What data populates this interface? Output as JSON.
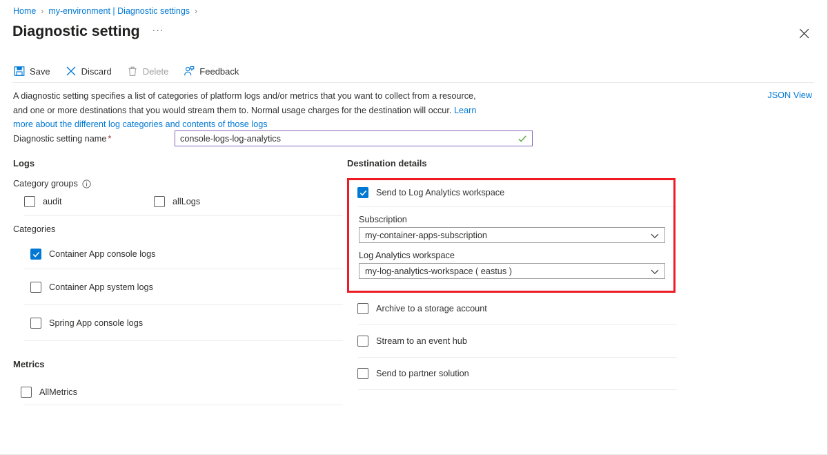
{
  "breadcrumb": {
    "items": [
      {
        "label": "Home",
        "separator": "›"
      },
      {
        "label": "my-environment | Diagnostic settings",
        "separator": "›"
      }
    ]
  },
  "header": {
    "title": "Diagnostic setting",
    "more_label": "···",
    "close_icon": "close-icon"
  },
  "toolbar": {
    "save_label": "Save",
    "discard_label": "Discard",
    "delete_label": "Delete",
    "feedback_label": "Feedback"
  },
  "description": {
    "line1": "A diagnostic setting specifies a list of categories of platform logs and/or metrics that you want to collect from a resource,",
    "line2": "and one or more destinations that you would stream them to. Normal usage charges for the destination will occur. ",
    "link_text": "Learn more about the different log categories and contents of those logs",
    "json_view_label": "JSON View"
  },
  "name_field": {
    "label": "Diagnostic setting name",
    "required_marker": "*",
    "value": "console-logs-log-analytics",
    "placeholder": "",
    "valid": true,
    "border_color": "#8764b8",
    "check_color": "#5aa63a"
  },
  "logs": {
    "section_title": "Logs",
    "category_groups": {
      "label": "Category groups",
      "info_icon": "info-icon",
      "items": [
        {
          "label": "audit",
          "checked": false
        },
        {
          "label": "allLogs",
          "checked": false
        }
      ]
    },
    "categories": {
      "label": "Categories",
      "items": [
        {
          "label": "Container App console logs",
          "checked": true
        },
        {
          "label": "Container App system logs",
          "checked": false
        },
        {
          "label": "Spring App console logs",
          "checked": false
        }
      ]
    }
  },
  "metrics": {
    "section_title": "Metrics",
    "items": [
      {
        "label": "AllMetrics",
        "checked": false
      }
    ]
  },
  "destination": {
    "section_title": "Destination details",
    "highlight_color": "#ee1b24",
    "log_analytics": {
      "label": "Send to Log Analytics workspace",
      "checked": true,
      "subscription": {
        "label": "Subscription",
        "value": "my-container-apps-subscription"
      },
      "workspace": {
        "label": "Log Analytics workspace",
        "value": "my-log-analytics-workspace ( eastus )"
      }
    },
    "other_options": [
      {
        "label": "Archive to a storage account",
        "checked": false
      },
      {
        "label": "Stream to an event hub",
        "checked": false
      },
      {
        "label": "Send to partner solution",
        "checked": false
      }
    ]
  },
  "colors": {
    "accent": "#0078d4",
    "link": "#0078d4",
    "required": "#a4262c",
    "highlight": "#ee1b24",
    "checkbox_checked": "#0078d4"
  }
}
